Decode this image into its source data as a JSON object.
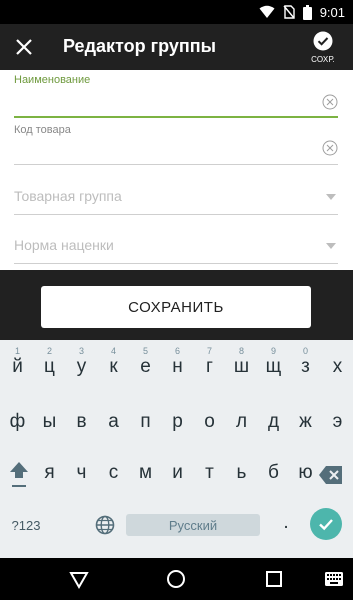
{
  "status_bar": {
    "time": "9:01",
    "icons": [
      "wifi-icon",
      "no-sim-icon",
      "battery-icon"
    ]
  },
  "app_bar": {
    "title": "Редактор группы",
    "close_icon": "close-icon",
    "save_label": "СОХР.",
    "save_icon": "check-circle-icon"
  },
  "form": {
    "name_label": "Наименование",
    "name_value": "",
    "code_label": "Код товара",
    "code_value": "",
    "group_placeholder": "Товарная группа",
    "markup_placeholder": "Норма наценки"
  },
  "save_button": "СОХРАНИТЬ",
  "keyboard": {
    "row1": [
      {
        "char": "й",
        "hint": "1"
      },
      {
        "char": "ц",
        "hint": "2"
      },
      {
        "char": "у",
        "hint": "3"
      },
      {
        "char": "к",
        "hint": "4"
      },
      {
        "char": "е",
        "hint": "5"
      },
      {
        "char": "н",
        "hint": "6"
      },
      {
        "char": "г",
        "hint": "7"
      },
      {
        "char": "ш",
        "hint": "8"
      },
      {
        "char": "щ",
        "hint": "9"
      },
      {
        "char": "з",
        "hint": "0"
      },
      {
        "char": "х",
        "hint": ""
      }
    ],
    "row2": [
      "ф",
      "ы",
      "в",
      "а",
      "п",
      "р",
      "о",
      "л",
      "д",
      "ж",
      "э"
    ],
    "row3": [
      "я",
      "ч",
      "с",
      "м",
      "и",
      "т",
      "ь",
      "б",
      "ю"
    ],
    "symbols_label": "?123",
    "space_label": "Русский",
    "period": ".",
    "accent_color": "#4db6ac"
  },
  "nav_bar": {
    "icons": [
      "back-icon",
      "home-icon",
      "recents-icon",
      "keyboard-switch-icon"
    ]
  },
  "colors": {
    "active_field": "#7cb342",
    "dark_bg": "#212121"
  }
}
